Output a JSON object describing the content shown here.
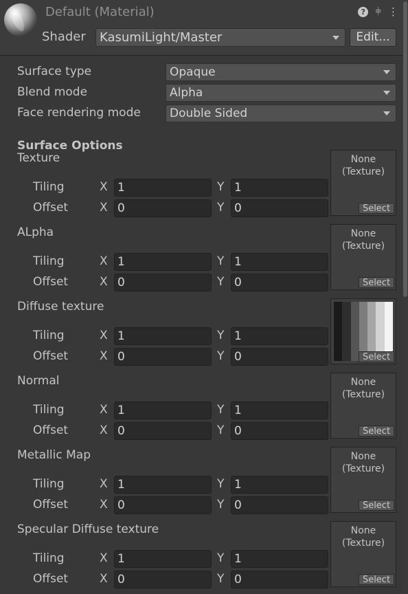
{
  "header": {
    "title": "Default (Material)",
    "shader_label": "Shader",
    "shader_value": "KasumiLight/Master",
    "edit_button": "Edit..."
  },
  "settings": [
    {
      "label": "Surface type",
      "value": "Opaque"
    },
    {
      "label": "Blend mode",
      "value": "Alpha"
    },
    {
      "label": "Face rendering mode",
      "value": "Double Sided"
    }
  ],
  "section_title": "Surface Options",
  "labels": {
    "tiling": "Tiling",
    "offset": "Offset",
    "x": "X",
    "y": "Y",
    "select": "Select"
  },
  "textures": [
    {
      "name": "Texture",
      "tiling_x": "1",
      "tiling_y": "1",
      "offset_x": "0",
      "offset_y": "0",
      "slot_line1": "None",
      "slot_line2": "(Texture)",
      "has_preview": false
    },
    {
      "name": "ALpha",
      "tiling_x": "1",
      "tiling_y": "1",
      "offset_x": "0",
      "offset_y": "0",
      "slot_line1": "None",
      "slot_line2": "(Texture)",
      "has_preview": false
    },
    {
      "name": "Diffuse texture",
      "tiling_x": "1",
      "tiling_y": "1",
      "offset_x": "0",
      "offset_y": "0",
      "slot_line1": "",
      "slot_line2": "",
      "has_preview": true
    },
    {
      "name": "Normal",
      "tiling_x": "1",
      "tiling_y": "1",
      "offset_x": "0",
      "offset_y": "0",
      "slot_line1": "None",
      "slot_line2": "(Texture)",
      "has_preview": false
    },
    {
      "name": "Metallic Map",
      "tiling_x": "1",
      "tiling_y": "1",
      "offset_x": "0",
      "offset_y": "0",
      "slot_line1": "None",
      "slot_line2": "(Texture)",
      "has_preview": false
    },
    {
      "name": "Specular Diffuse texture",
      "tiling_x": "1",
      "tiling_y": "1",
      "offset_x": "0",
      "offset_y": "0",
      "slot_line1": "None",
      "slot_line2": "(Texture)",
      "has_preview": false
    }
  ],
  "icons": {
    "material": "sphere-material-icon",
    "help": "help-icon",
    "presets": "sliders-icon",
    "menu": "kebab-menu-icon"
  },
  "colors": {
    "background": "#383838",
    "field": "#2a2a2a",
    "text": "#c4c4c4"
  }
}
